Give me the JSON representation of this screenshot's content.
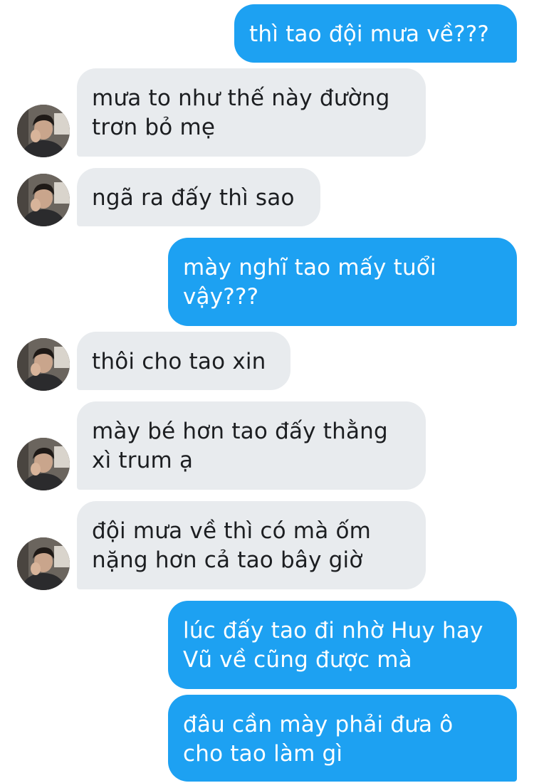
{
  "conversation": {
    "messages": [
      {
        "direction": "outgoing",
        "lines": [
          "thì tao đội mưa về???"
        ]
      },
      {
        "direction": "incoming",
        "lines": [
          "mưa to như thế này đường",
          "trơn bỏ mẹ"
        ]
      },
      {
        "direction": "incoming",
        "lines": [
          "ngã ra đấy thì sao"
        ]
      },
      {
        "direction": "outgoing",
        "lines": [
          "mày nghĩ tao mấy tuổi",
          "vậy???"
        ]
      },
      {
        "direction": "incoming",
        "lines": [
          "thôi cho tao xin"
        ]
      },
      {
        "direction": "incoming",
        "lines": [
          "mày bé hơn tao đấy thằng",
          "xì trum ạ"
        ]
      },
      {
        "direction": "incoming",
        "lines": [
          "đội mưa về thì có mà ốm",
          "nặng hơn cả tao bây giờ"
        ]
      },
      {
        "direction": "outgoing",
        "lines": [
          "lúc đấy tao đi nhờ Huy hay",
          "Vũ về cũng được mà"
        ]
      },
      {
        "direction": "outgoing",
        "lines": [
          "đâu cần mày phải đưa ô",
          "cho tao làm gì"
        ]
      }
    ]
  },
  "colors": {
    "outgoing_bubble": "#1da1f2",
    "incoming_bubble": "#e8ebee",
    "incoming_text": "#1c1e21",
    "outgoing_text": "#ffffff"
  },
  "icons": {
    "contact_avatar": "person-avatar-photo"
  }
}
